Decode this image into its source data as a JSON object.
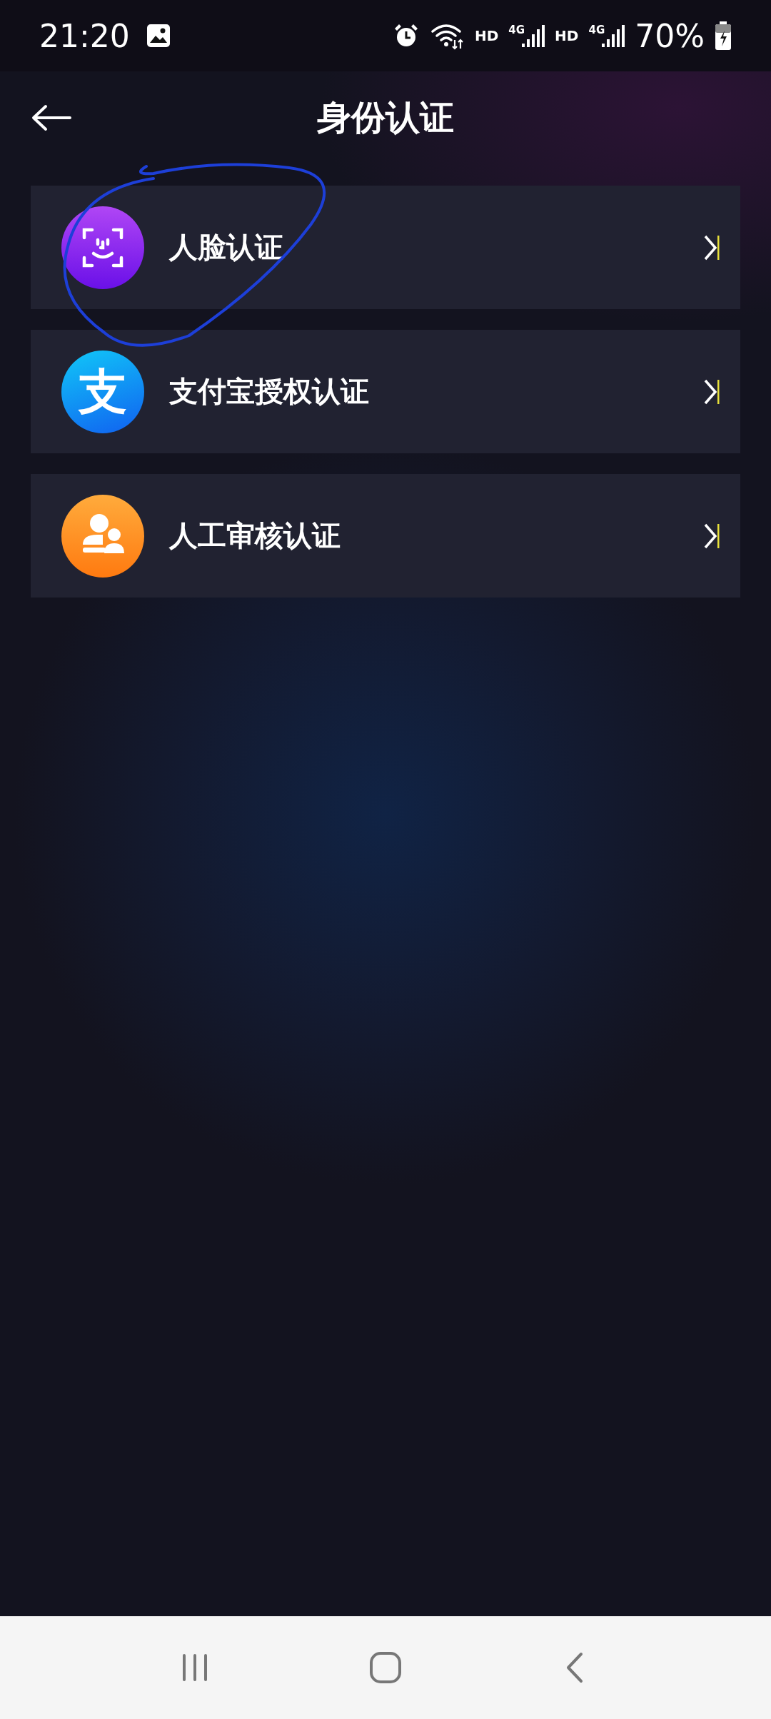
{
  "status_bar": {
    "time": "21:20",
    "network_labels": [
      "HD",
      "4G",
      "HD",
      "4G"
    ],
    "battery": "70%"
  },
  "header": {
    "title": "身份认证"
  },
  "items": [
    {
      "kind": "face",
      "label": "人脸认证"
    },
    {
      "kind": "alipay",
      "label": "支付宝授权认证",
      "glyph": "支"
    },
    {
      "kind": "manual",
      "label": "人工审核认证"
    }
  ]
}
